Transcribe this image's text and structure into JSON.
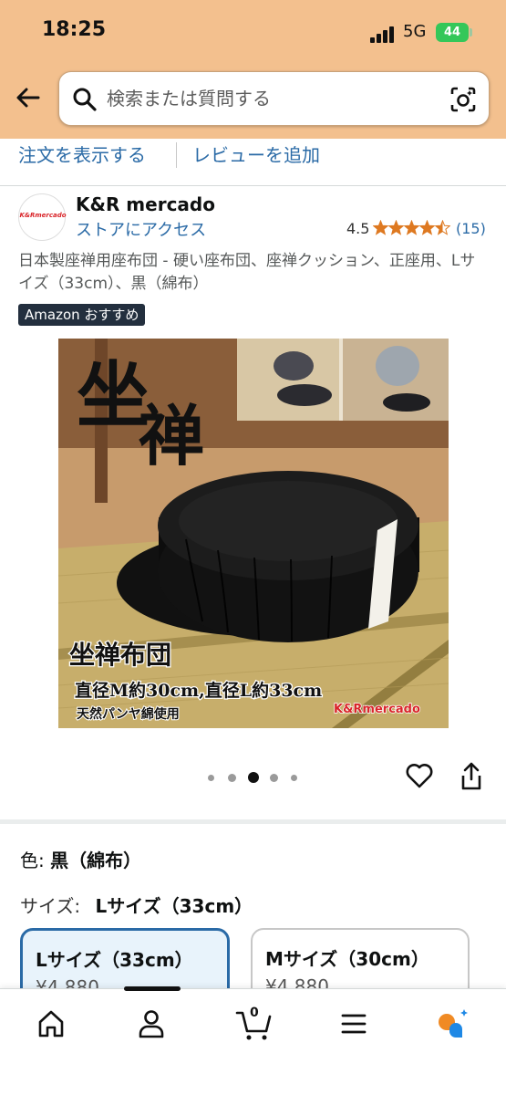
{
  "status_bar": {
    "time": "18:25",
    "network": "5G",
    "battery": "44"
  },
  "search": {
    "placeholder": "検索または質問する"
  },
  "actions": {
    "view_orders": "注文を表示する",
    "add_review": "レビューを追加"
  },
  "seller": {
    "logo_text": "K&Rmercado",
    "name": "K&R mercado",
    "store_link": "ストアにアクセス",
    "rating": "4.5",
    "star_rating": 4.5,
    "review_count": "(15)"
  },
  "product": {
    "title": "日本製座禅用座布団 - 硬い座布団、座禅クッション、正座用、Lサイズ（33cm）、黒（綿布）",
    "badge": "Amazon おすすめ",
    "image_text": {
      "big1": "坐",
      "big2": "禅",
      "headline": "坐禅布団",
      "dimensions": "直径M約30cm,直径L約33cm",
      "material": "天然パンヤ綿使用",
      "brand": "K&Rmercado"
    },
    "carousel": {
      "count": 5,
      "active_index": 2
    }
  },
  "variant": {
    "color_label": "色:",
    "color_value": "黒（綿布）",
    "size_label": "サイズ:",
    "size_value": "Lサイズ（33cm）",
    "options": [
      {
        "label": "Lサイズ（33cm）",
        "price": "¥4,880",
        "selected": true
      },
      {
        "label": "Mサイズ（30cm）",
        "price": "¥4,880",
        "selected": false
      }
    ]
  },
  "nav": {
    "cart_count": "0"
  },
  "colors": {
    "header": "#f3c08e",
    "link": "#2a6aa6",
    "star": "#de7921",
    "badge": "#232f3e",
    "selected_border": "#2a6aa6"
  }
}
